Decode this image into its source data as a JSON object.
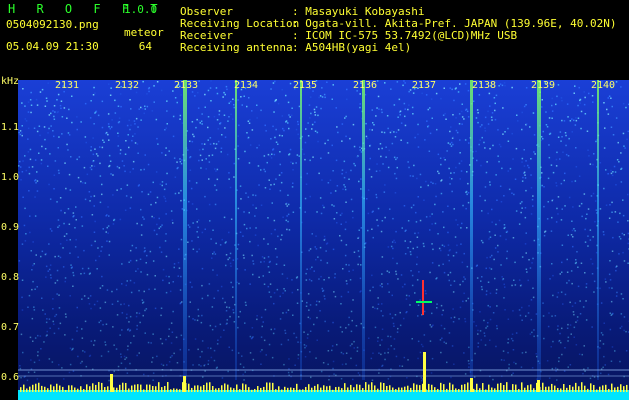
{
  "app": {
    "title": "H R O F F T",
    "version": "1.0.0",
    "filename": "0504092130.png",
    "datetime": "05.04.09 21:30",
    "count_label": "meteor",
    "count_value": "64"
  },
  "info": {
    "rows": [
      {
        "label": "Observer",
        "value": ": Masayuki Kobayashi"
      },
      {
        "label": "Receiving Location",
        "value": ": Ogata-vill. Akita-Pref. JAPAN (139.96E, 40.02N)"
      },
      {
        "label": "Receiver",
        "value": ": ICOM IC-575 53.7492(@LCD)MHz USB"
      },
      {
        "label": "Receiving antenna",
        "value": ": A504HB(yagi 4el)"
      }
    ]
  },
  "axis": {
    "unit": "kHz",
    "y_ticks": [
      "1.1",
      "1.0",
      "0.9",
      "0.8",
      "0.7",
      "0.6"
    ],
    "x_ticks": [
      "2131",
      "2132",
      "2133",
      "2134",
      "2135",
      "2136",
      "2137",
      "2138",
      "2139",
      "2140"
    ]
  },
  "colors": {
    "background": "#000000",
    "text": "#ffff33",
    "title": "#2bff2b",
    "spectrum_base": "#0a1a8c",
    "bottom_band": "#00e5ff"
  }
}
